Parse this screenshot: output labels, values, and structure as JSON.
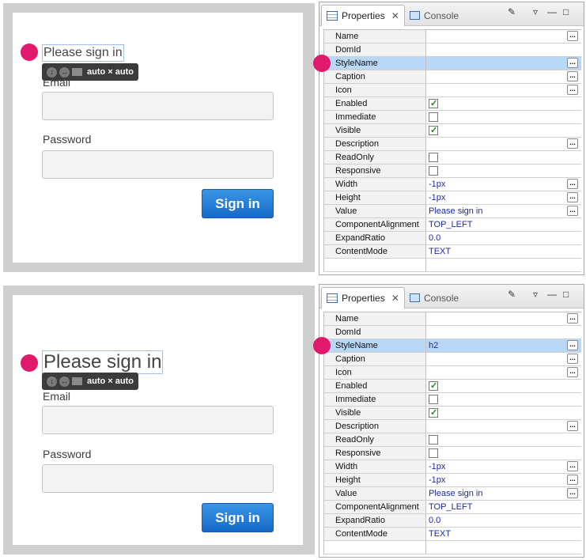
{
  "panels": [
    {
      "form": {
        "title": "Please sign in",
        "size_label": "auto × auto",
        "email_label": "Email",
        "password_label": "Password",
        "signin_label": "Sign in"
      },
      "props": {
        "tab_properties": "Properties",
        "tab_console": "Console",
        "rows": [
          {
            "name": "Name",
            "value": "",
            "kind": "text",
            "ellipsis": true
          },
          {
            "name": "DomId",
            "value": "",
            "kind": "text",
            "ellipsis": false
          },
          {
            "name": "StyleName",
            "value": "",
            "kind": "text",
            "ellipsis": true,
            "highlight": true
          },
          {
            "name": "Caption",
            "value": "",
            "kind": "text",
            "ellipsis": true
          },
          {
            "name": "Icon",
            "value": "",
            "kind": "text",
            "ellipsis": true
          },
          {
            "name": "Enabled",
            "value": "",
            "kind": "checkbox",
            "checked": true
          },
          {
            "name": "Immediate",
            "value": "",
            "kind": "checkbox",
            "checked": false
          },
          {
            "name": "Visible",
            "value": "",
            "kind": "checkbox",
            "checked": true
          },
          {
            "name": "Description",
            "value": "",
            "kind": "text",
            "ellipsis": true
          },
          {
            "name": "ReadOnly",
            "value": "",
            "kind": "checkbox",
            "checked": false
          },
          {
            "name": "Responsive",
            "value": "",
            "kind": "checkbox",
            "checked": false
          },
          {
            "name": "Width",
            "value": "-1px",
            "kind": "text",
            "ellipsis": true
          },
          {
            "name": "Height",
            "value": "-1px",
            "kind": "text",
            "ellipsis": true
          },
          {
            "name": "Value",
            "value": "Please sign in",
            "kind": "text",
            "ellipsis": true
          },
          {
            "name": "ComponentAlignment",
            "value": "TOP_LEFT",
            "kind": "text",
            "ellipsis": false
          },
          {
            "name": "ExpandRatio",
            "value": "0.0",
            "kind": "text",
            "ellipsis": false
          },
          {
            "name": "ContentMode",
            "value": "TEXT",
            "kind": "text",
            "ellipsis": false
          }
        ]
      }
    },
    {
      "form": {
        "title": "Please sign in",
        "size_label": "auto × auto",
        "email_label": "Email",
        "password_label": "Password",
        "signin_label": "Sign in"
      },
      "props": {
        "tab_properties": "Properties",
        "tab_console": "Console",
        "rows": [
          {
            "name": "Name",
            "value": "",
            "kind": "text",
            "ellipsis": true
          },
          {
            "name": "DomId",
            "value": "",
            "kind": "text",
            "ellipsis": false
          },
          {
            "name": "StyleName",
            "value": "h2",
            "kind": "text",
            "ellipsis": true,
            "highlight": true
          },
          {
            "name": "Caption",
            "value": "",
            "kind": "text",
            "ellipsis": true
          },
          {
            "name": "Icon",
            "value": "",
            "kind": "text",
            "ellipsis": true
          },
          {
            "name": "Enabled",
            "value": "",
            "kind": "checkbox",
            "checked": true
          },
          {
            "name": "Immediate",
            "value": "",
            "kind": "checkbox",
            "checked": false
          },
          {
            "name": "Visible",
            "value": "",
            "kind": "checkbox",
            "checked": true
          },
          {
            "name": "Description",
            "value": "",
            "kind": "text",
            "ellipsis": true
          },
          {
            "name": "ReadOnly",
            "value": "",
            "kind": "checkbox",
            "checked": false
          },
          {
            "name": "Responsive",
            "value": "",
            "kind": "checkbox",
            "checked": false
          },
          {
            "name": "Width",
            "value": "-1px",
            "kind": "text",
            "ellipsis": true
          },
          {
            "name": "Height",
            "value": "-1px",
            "kind": "text",
            "ellipsis": true
          },
          {
            "name": "Value",
            "value": "Please sign in",
            "kind": "text",
            "ellipsis": true
          },
          {
            "name": "ComponentAlignment",
            "value": "TOP_LEFT",
            "kind": "text",
            "ellipsis": false
          },
          {
            "name": "ExpandRatio",
            "value": "0.0",
            "kind": "text",
            "ellipsis": false
          },
          {
            "name": "ContentMode",
            "value": "TEXT",
            "kind": "text",
            "ellipsis": false
          }
        ]
      }
    }
  ],
  "colors": {
    "marker": "#e0196c",
    "highlight_row": "#b9d7f7",
    "signin_button": "#1f7ad6"
  }
}
